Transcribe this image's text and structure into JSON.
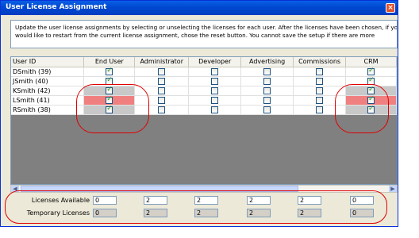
{
  "window": {
    "title": "User License Assignment",
    "close_glyph": "×"
  },
  "instructions": "Update the user license assignments by selecting or unselecting the licenses for each user.  After the licenses have been chosen, if you\nwould like to restart from the current license assignment, chose the reset button.  You cannot save the setup if there are more",
  "columns": [
    "User ID",
    "End User",
    "Administrator",
    "Developer",
    "Advertising",
    "Commissions",
    "CRM"
  ],
  "rows": [
    {
      "user": "DSmith (39)",
      "checks": [
        true,
        false,
        false,
        false,
        false,
        true
      ]
    },
    {
      "user": "JSmith (40)",
      "checks": [
        true,
        false,
        false,
        false,
        false,
        true
      ]
    },
    {
      "user": "KSmith (42)",
      "checks": [
        true,
        false,
        false,
        false,
        false,
        true
      ]
    },
    {
      "user": "LSmith (41)",
      "checks": [
        true,
        false,
        false,
        false,
        false,
        true
      ]
    },
    {
      "user": "RSmith (38)",
      "checks": [
        true,
        false,
        false,
        false,
        false,
        true
      ]
    }
  ],
  "licenses_available_label": "Licenses Available",
  "temporary_licenses_label": "Temporary Licenses",
  "licenses_available": [
    "0",
    "2",
    "2",
    "2",
    "2",
    "0"
  ],
  "temporary_licenses": [
    "0",
    "2",
    "2",
    "2",
    "2",
    "0"
  ],
  "colors": {
    "accent": "#0048d0",
    "highlight_red": "#f08080",
    "annotation_red": "#e00000"
  }
}
